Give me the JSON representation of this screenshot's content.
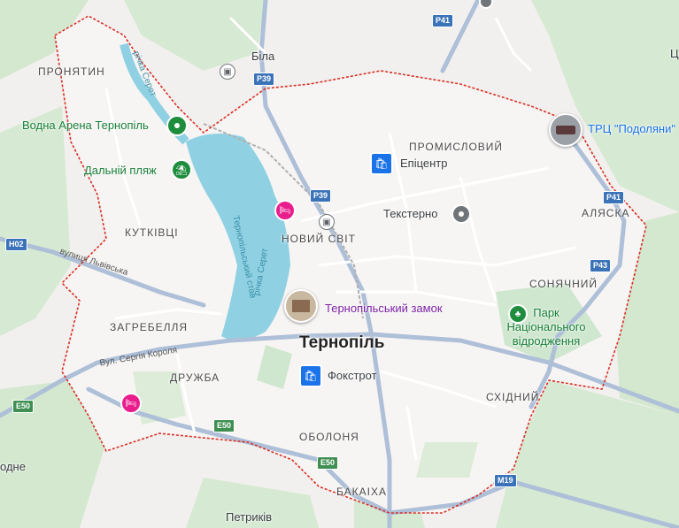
{
  "city": {
    "name": "Тернопіль"
  },
  "districts": [
    {
      "id": "pronyatyn",
      "label": "ПРОНЯТИН"
    },
    {
      "id": "kutkivtsi",
      "label": "КУТКІВЦІ"
    },
    {
      "id": "zahrebellia",
      "label": "ЗАГРЕБЕЛЛЯ"
    },
    {
      "id": "druzhba",
      "label": "ДРУЖБА"
    },
    {
      "id": "novyi-svit",
      "label": "НОВИЙ СВІТ"
    },
    {
      "id": "promyslovyi",
      "label": "ПРОМИСЛОВИЙ"
    },
    {
      "id": "aliaska",
      "label": "АЛЯСКА"
    },
    {
      "id": "soniachnyi",
      "label": "СОНЯЧНИЙ"
    },
    {
      "id": "skhidnyi",
      "label": "СХІДНИЙ"
    },
    {
      "id": "obolonia",
      "label": "ОБОЛОНЯ"
    },
    {
      "id": "bakaikha",
      "label": "БАКАІХА"
    }
  ],
  "villages": [
    {
      "id": "bila",
      "label": "Біла"
    },
    {
      "id": "petrykiv",
      "label": "Петриків"
    },
    {
      "id": "edge-left",
      "label": "одне"
    }
  ],
  "pois": [
    {
      "id": "vodna-arena",
      "label": "Водна Арена Тернопіль",
      "icon": "pin-icon",
      "color": "#1e8e3e"
    },
    {
      "id": "dalnyi-pliazh",
      "label": "Дальній пляж",
      "icon": "beach-icon",
      "color": "#1e8e3e"
    },
    {
      "id": "epitsentr",
      "label": "Епіцентр",
      "icon": "shopping-bag-icon",
      "color": "#1a73e8"
    },
    {
      "id": "teksterno",
      "label": "Текстерно",
      "icon": "pin-icon",
      "color": "#5f6368"
    },
    {
      "id": "trts-podoliany",
      "label": "ТРЦ \"Подоляни\"",
      "icon": "mall-photo-icon",
      "color": "#1a73e8"
    },
    {
      "id": "ternopil-castle",
      "label": "Тернопільський замок",
      "icon": "castle-photo-icon",
      "color": "#7b1fa2"
    },
    {
      "id": "park",
      "label": "Парк\nНаціонального\nвідродження",
      "icon": "park-icon",
      "color": "#188038"
    },
    {
      "id": "fokstrot",
      "label": "Фокстрот",
      "icon": "shopping-bag-icon",
      "color": "#1a73e8"
    },
    {
      "id": "hotel-1",
      "label": "",
      "icon": "bed-icon",
      "color": "#e91e8c"
    },
    {
      "id": "hotel-2",
      "label": "",
      "icon": "bed-icon",
      "color": "#e91e8c"
    }
  ],
  "water": [
    {
      "id": "river-seret-north",
      "label": "річка Серет"
    },
    {
      "id": "river-seret-lake",
      "label": "річка Серет"
    },
    {
      "id": "ternopil-lake",
      "label": "Тернопільський став"
    }
  ],
  "streets": [
    {
      "id": "lvivska",
      "label": "вулиця Львівська"
    },
    {
      "id": "serhiia-korolia",
      "label": "Вул. Сергія Короля"
    }
  ],
  "road_shields": [
    {
      "id": "p41-top",
      "label": "P41",
      "color": "#3b73b9"
    },
    {
      "id": "p39-a",
      "label": "P39",
      "color": "#3b73b9"
    },
    {
      "id": "p39-b",
      "label": "P39",
      "color": "#3b73b9"
    },
    {
      "id": "p41-east",
      "label": "P41",
      "color": "#3b73b9"
    },
    {
      "id": "p43",
      "label": "P43",
      "color": "#3b73b9"
    },
    {
      "id": "h02",
      "label": "H02",
      "color": "#3b73b9"
    },
    {
      "id": "e50-west",
      "label": "E50",
      "color": "#3f8f52"
    },
    {
      "id": "e50-mid",
      "label": "E50",
      "color": "#3f8f52"
    },
    {
      "id": "e50-south",
      "label": "E50",
      "color": "#3f8f52"
    },
    {
      "id": "m19",
      "label": "M19",
      "color": "#3b73b9"
    }
  ],
  "edge_text": {
    "top_right": "Ц"
  },
  "colors": {
    "land": "#f2f0ee",
    "green": "#cfe6cf",
    "water": "#8fd1e3",
    "boundary": "#d93025",
    "road": "#aebfd8"
  }
}
